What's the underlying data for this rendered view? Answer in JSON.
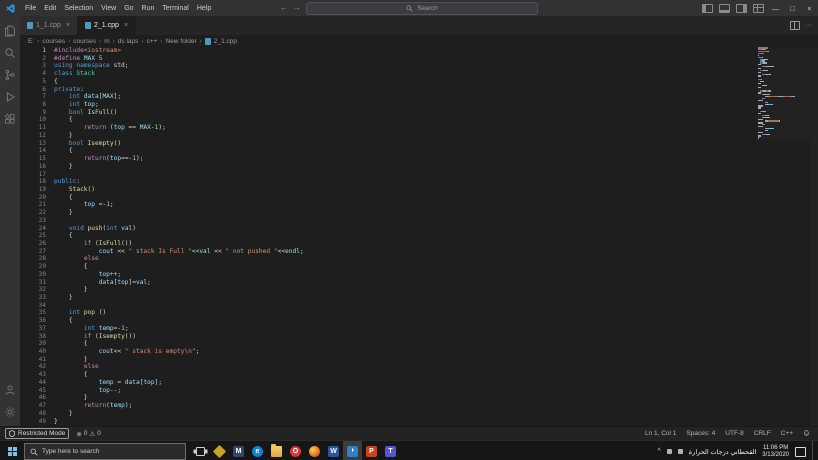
{
  "colors": {
    "pp": "#C586C0",
    "kw": "#569CD6",
    "ctl": "#C586C0",
    "type": "#4EC9B2",
    "fn": "#DCDCAA",
    "var": "#9CDCFE",
    "num": "#B5CEA8",
    "str": "#CE9178",
    "pl": "#D4D4D4",
    "def": "#9CDCFE",
    "accent": "#007ACC",
    "editor_bg": "#1e1e1e"
  },
  "title_bar": {
    "menus": [
      "File",
      "Edit",
      "Selection",
      "View",
      "Go",
      "Run",
      "Terminal",
      "Help"
    ],
    "search_label": "Search"
  },
  "tab_bar": {
    "tabs": [
      {
        "label": "1_1.cpp",
        "active": false
      },
      {
        "label": "2_1.cpp",
        "active": true
      }
    ]
  },
  "breadcrumb": [
    "E:",
    "courses",
    "courses",
    "m",
    "ds laps",
    "c++",
    "New folder",
    "2_1.cpp"
  ],
  "activity_bar": {
    "icons": [
      "explorer",
      "search",
      "source-control",
      "run-debug",
      "extensions"
    ],
    "bottom_icons": [
      "account",
      "settings"
    ]
  },
  "editor": {
    "lines": [
      [
        [
          "pp",
          "#include"
        ],
        [
          "str",
          "<iostream>"
        ]
      ],
      [
        [
          "pp",
          "#define "
        ],
        [
          "def",
          "MAX "
        ],
        [
          "num",
          "5"
        ]
      ],
      [
        [
          "kw",
          "using namespace "
        ],
        [
          "pl",
          "std;"
        ]
      ],
      [
        [
          "kw",
          "class "
        ],
        [
          "type",
          "Stack"
        ]
      ],
      [
        [
          "pl",
          "{"
        ]
      ],
      [
        [
          "kw",
          "private"
        ],
        [
          "pl",
          ":"
        ]
      ],
      [
        [
          "pl",
          "    "
        ],
        [
          "kw",
          "int "
        ],
        [
          "var",
          "data"
        ],
        [
          "pl",
          "["
        ],
        [
          "def",
          "MAX"
        ],
        [
          "pl",
          "];"
        ]
      ],
      [
        [
          "pl",
          "    "
        ],
        [
          "kw",
          "int "
        ],
        [
          "var",
          "top"
        ],
        [
          "pl",
          ";"
        ]
      ],
      [
        [
          "pl",
          "    "
        ],
        [
          "kw",
          "bool "
        ],
        [
          "fn",
          "IsFull"
        ],
        [
          "pl",
          "()"
        ]
      ],
      [
        [
          "pl",
          "    {"
        ]
      ],
      [
        [
          "pl",
          "        "
        ],
        [
          "ctl",
          "return"
        ],
        [
          "pl",
          " ("
        ],
        [
          "var",
          "top"
        ],
        [
          "pl",
          " == "
        ],
        [
          "def",
          "MAX"
        ],
        [
          "pl",
          "-"
        ],
        [
          "num",
          "1"
        ],
        [
          "pl",
          ");"
        ]
      ],
      [
        [
          "pl",
          "    }"
        ]
      ],
      [
        [
          "pl",
          "    "
        ],
        [
          "kw",
          "bool "
        ],
        [
          "fn",
          "Isempty"
        ],
        [
          "pl",
          "()"
        ]
      ],
      [
        [
          "pl",
          "    {"
        ]
      ],
      [
        [
          "pl",
          "        "
        ],
        [
          "ctl",
          "return"
        ],
        [
          "pl",
          "("
        ],
        [
          "var",
          "top"
        ],
        [
          "pl",
          "==-"
        ],
        [
          "num",
          "1"
        ],
        [
          "pl",
          ");"
        ]
      ],
      [
        [
          "pl",
          "    }"
        ]
      ],
      [],
      [
        [
          "kw",
          "public"
        ],
        [
          "pl",
          ":"
        ]
      ],
      [
        [
          "pl",
          "    "
        ],
        [
          "fn",
          "Stack"
        ],
        [
          "pl",
          "()"
        ]
      ],
      [
        [
          "pl",
          "    {"
        ]
      ],
      [
        [
          "pl",
          "        "
        ],
        [
          "var",
          "top"
        ],
        [
          "pl",
          " =-"
        ],
        [
          "num",
          "1"
        ],
        [
          "pl",
          ";"
        ]
      ],
      [
        [
          "pl",
          "    }"
        ]
      ],
      [],
      [
        [
          "pl",
          "    "
        ],
        [
          "kw",
          "void "
        ],
        [
          "fn",
          "push"
        ],
        [
          "pl",
          "("
        ],
        [
          "kw",
          "int "
        ],
        [
          "var",
          "val"
        ],
        [
          "pl",
          ")"
        ]
      ],
      [
        [
          "pl",
          "    {"
        ]
      ],
      [
        [
          "pl",
          "        "
        ],
        [
          "ctl",
          "if"
        ],
        [
          "pl",
          " ("
        ],
        [
          "fn",
          "IsFull"
        ],
        [
          "pl",
          "())"
        ]
      ],
      [
        [
          "pl",
          "            "
        ],
        [
          "var",
          "cout"
        ],
        [
          "pl",
          " << "
        ],
        [
          "str",
          "\" stack Is Full \""
        ],
        [
          "pl",
          "<<"
        ],
        [
          "var",
          "val"
        ],
        [
          "pl",
          " << "
        ],
        [
          "str",
          "\" not pushed \""
        ],
        [
          "pl",
          "<<"
        ],
        [
          "var",
          "endl"
        ],
        [
          "pl",
          ";"
        ]
      ],
      [
        [
          "pl",
          "        "
        ],
        [
          "ctl",
          "else"
        ]
      ],
      [
        [
          "pl",
          "        {"
        ]
      ],
      [
        [
          "pl",
          "            "
        ],
        [
          "var",
          "top"
        ],
        [
          "pl",
          "++;"
        ]
      ],
      [
        [
          "pl",
          "            "
        ],
        [
          "var",
          "data"
        ],
        [
          "pl",
          "["
        ],
        [
          "var",
          "top"
        ],
        [
          "pl",
          "]="
        ],
        [
          "var",
          "val"
        ],
        [
          "pl",
          ";"
        ]
      ],
      [
        [
          "pl",
          "        }"
        ]
      ],
      [
        [
          "pl",
          "    }"
        ]
      ],
      [],
      [
        [
          "pl",
          "    "
        ],
        [
          "kw",
          "int "
        ],
        [
          "fn",
          "pop"
        ],
        [
          "pl",
          " ()"
        ]
      ],
      [
        [
          "pl",
          "    {"
        ]
      ],
      [
        [
          "pl",
          "        "
        ],
        [
          "kw",
          "int "
        ],
        [
          "var",
          "temp"
        ],
        [
          "pl",
          "=-"
        ],
        [
          "num",
          "1"
        ],
        [
          "pl",
          ";"
        ]
      ],
      [
        [
          "pl",
          "        "
        ],
        [
          "ctl",
          "if"
        ],
        [
          "pl",
          " ("
        ],
        [
          "fn",
          "Isempty"
        ],
        [
          "pl",
          "())"
        ]
      ],
      [
        [
          "pl",
          "        {"
        ]
      ],
      [
        [
          "pl",
          "            "
        ],
        [
          "var",
          "cout"
        ],
        [
          "pl",
          "<< "
        ],
        [
          "str",
          "\" stack is empty\\n\""
        ],
        [
          "pl",
          ";"
        ]
      ],
      [
        [
          "pl",
          "        }"
        ]
      ],
      [
        [
          "pl",
          "        "
        ],
        [
          "ctl",
          "else"
        ]
      ],
      [
        [
          "pl",
          "        {"
        ]
      ],
      [
        [
          "pl",
          "            "
        ],
        [
          "var",
          "temp"
        ],
        [
          "pl",
          " = "
        ],
        [
          "var",
          "data"
        ],
        [
          "pl",
          "["
        ],
        [
          "var",
          "top"
        ],
        [
          "pl",
          "];"
        ]
      ],
      [
        [
          "pl",
          "            "
        ],
        [
          "var",
          "top"
        ],
        [
          "pl",
          "--;"
        ]
      ],
      [
        [
          "pl",
          "        }"
        ]
      ],
      [
        [
          "pl",
          "        "
        ],
        [
          "ctl",
          "return"
        ],
        [
          "pl",
          "("
        ],
        [
          "var",
          "temp"
        ],
        [
          "pl",
          ");"
        ]
      ],
      [
        [
          "pl",
          "    }"
        ]
      ],
      [
        [
          "pl",
          "}"
        ]
      ]
    ]
  },
  "status_bar": {
    "restricted_mode": "Restricted Mode",
    "errors": "0",
    "warnings": "0",
    "line_col": "Ln 1, Col 1",
    "spaces": "Spaces: 4",
    "encoding": "UTF-8",
    "eol": "CRLF",
    "language": "C++"
  },
  "taskbar": {
    "search_placeholder": "Type here to search",
    "apps": [
      {
        "name": "task-view"
      },
      {
        "name": "photos",
        "color": "#c9a227"
      },
      {
        "name": "mail",
        "color": "#2e4a6b",
        "label": "M"
      },
      {
        "name": "edge",
        "color": "#0c86d4",
        "label": "e"
      },
      {
        "name": "file-explorer"
      },
      {
        "name": "opera",
        "color": "#d63a3a",
        "label": "O"
      },
      {
        "name": "firefox"
      },
      {
        "name": "word",
        "color": "#2b579a",
        "label": "W"
      },
      {
        "name": "vscode",
        "color": "#2f80c7",
        "active": true
      },
      {
        "name": "powerpoint",
        "color": "#c4441c",
        "label": "P"
      },
      {
        "name": "teams",
        "color": "#5059c9",
        "label": "T"
      }
    ],
    "tray": {
      "news": "القحطاني درجات الحرارة",
      "time": "11:06 PM",
      "date": "3/13/2020"
    }
  }
}
